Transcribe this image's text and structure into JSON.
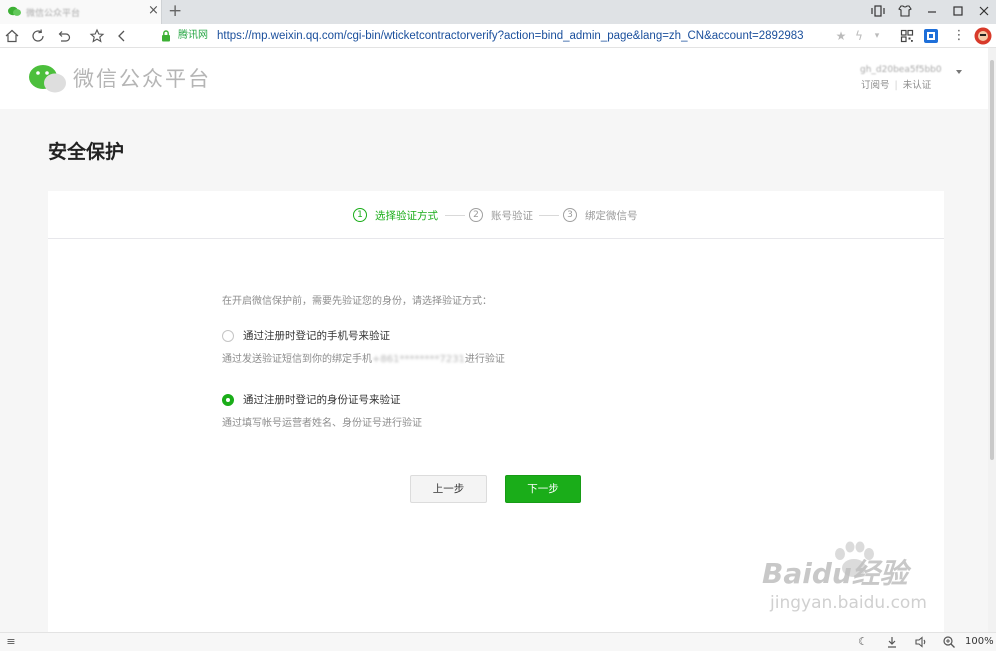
{
  "browser": {
    "tab_title": "微信公众平台",
    "close_glyph": "×",
    "new_tab_glyph": "+",
    "site_name": "腾讯网",
    "url": "https://mp.weixin.qq.com/cgi-bin/wticketcontractorverify?action=bind_admin_page&lang=zh_CN&account=2892983",
    "zoom": "100%",
    "accent_color": "#1a4f9c"
  },
  "header": {
    "platform_name": "微信公众平台",
    "account_name": "gh_d20bea5f5bb0",
    "account_type": "订阅号",
    "verify_status": "未认证"
  },
  "main": {
    "title": "安全保护",
    "steps": [
      {
        "num": "1",
        "label": "选择验证方式",
        "active": true
      },
      {
        "num": "2",
        "label": "账号验证",
        "active": false
      },
      {
        "num": "3",
        "label": "绑定微信号",
        "active": false
      }
    ],
    "prompt": "在开启微信保护前，需要先验证您的身份，请选择验证方式：",
    "options": [
      {
        "label": "通过注册时登记的手机号来验证",
        "desc_prefix": "通过发送验证短信到你的绑定手机",
        "desc_masked": "+861********7231",
        "desc_suffix": "进行验证",
        "checked": false
      },
      {
        "label": "通过注册时登记的身份证号来验证",
        "desc": "通过填写帐号运营者姓名、身份证号进行验证",
        "checked": true
      }
    ],
    "prev_button": "上一步",
    "next_button": "下一步",
    "accent_color": "#1aad19"
  },
  "watermark": {
    "brand": "Baidu经验",
    "url": "jingyan.baidu.com"
  }
}
